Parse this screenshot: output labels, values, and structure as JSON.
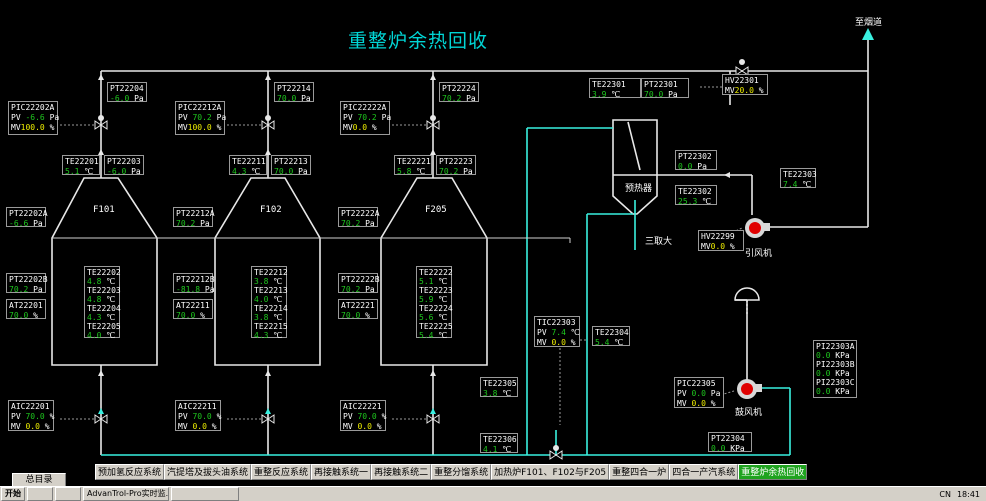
{
  "title": "重整炉余热回收",
  "exhaust_label": "至烟道",
  "reactors": [
    {
      "name": "F101",
      "pic": {
        "tag": "PIC22202A",
        "pv": "-6.6",
        "pv_unit": "Pa",
        "mv": "100.0",
        "mv_unit": "%"
      },
      "pt_top": {
        "tag": "PT22204",
        "value": "-6.0",
        "unit": "Pa"
      },
      "te_top": {
        "tag": "TE22201",
        "value": "5.1",
        "unit": "℃"
      },
      "pt_top2": {
        "tag": "PT22203",
        "value": "-6.0",
        "unit": "Pa"
      },
      "pt_side": {
        "tag": "PT22202A",
        "value": "-6.6",
        "unit": "Pa"
      },
      "pt_mid": {
        "tag": "PT22202B",
        "value": "70.2",
        "unit": "Pa"
      },
      "at": {
        "tag": "AT22201",
        "value": "70.0",
        "unit": "%"
      },
      "te_list": [
        {
          "tag": "TE22202",
          "value": "4.8",
          "unit": "℃"
        },
        {
          "tag": "TE22203",
          "value": "4.8",
          "unit": "℃"
        },
        {
          "tag": "TE22204",
          "value": "4.3",
          "unit": "℃"
        },
        {
          "tag": "TE22205",
          "value": "4.0",
          "unit": "℃"
        }
      ],
      "aic": {
        "tag": "AIC22201",
        "pv": "70.0",
        "pv_unit": "%",
        "mv": "0.0",
        "mv_unit": "%"
      }
    },
    {
      "name": "F102",
      "pic": {
        "tag": "PIC22212A",
        "pv": "70.2",
        "pv_unit": "Pa",
        "mv": "100.0",
        "mv_unit": "%"
      },
      "pt_top": {
        "tag": "PT22214",
        "value": "70.0",
        "unit": "Pa"
      },
      "te_top": {
        "tag": "TE22211",
        "value": "4.3",
        "unit": "℃"
      },
      "pt_top2": {
        "tag": "PT22213",
        "value": "70.0",
        "unit": "Pa"
      },
      "pt_side": {
        "tag": "PT22212A",
        "value": "70.2",
        "unit": "Pa"
      },
      "pt_mid": {
        "tag": "PT22212B",
        "value": "-81.8",
        "unit": "Pa"
      },
      "at": {
        "tag": "AT22211",
        "value": "70.0",
        "unit": "%"
      },
      "te_list": [
        {
          "tag": "TE22212",
          "value": "3.8",
          "unit": "℃"
        },
        {
          "tag": "TE22213",
          "value": "4.0",
          "unit": "℃"
        },
        {
          "tag": "TE22214",
          "value": "3.8",
          "unit": "℃"
        },
        {
          "tag": "TE22215",
          "value": "4.3",
          "unit": "℃"
        }
      ],
      "aic": {
        "tag": "AIC22211",
        "pv": "70.0",
        "pv_unit": "%",
        "mv": "0.0",
        "mv_unit": "%"
      }
    },
    {
      "name": "F205",
      "pic": {
        "tag": "PIC22222A",
        "pv": "70.2",
        "pv_unit": "Pa",
        "mv": "0.0",
        "mv_unit": "%"
      },
      "pt_top": {
        "tag": "PT22224",
        "value": "70.2",
        "unit": "Pa"
      },
      "te_top": {
        "tag": "TE22221",
        "value": "5.8",
        "unit": "℃"
      },
      "pt_top2": {
        "tag": "PT22223",
        "value": "70.2",
        "unit": "Pa"
      },
      "pt_side": {
        "tag": "PT22222A",
        "value": "70.2",
        "unit": "Pa"
      },
      "pt_mid": {
        "tag": "PT22222B",
        "value": "70.2",
        "unit": "Pa"
      },
      "at": {
        "tag": "AT22221",
        "value": "70.0",
        "unit": "%"
      },
      "te_list": [
        {
          "tag": "TE22222",
          "value": "5.1",
          "unit": "℃"
        },
        {
          "tag": "TE22223",
          "value": "5.9",
          "unit": "℃"
        },
        {
          "tag": "TE22224",
          "value": "5.6",
          "unit": "℃"
        },
        {
          "tag": "TE22225",
          "value": "5.4",
          "unit": "℃"
        }
      ],
      "aic": {
        "tag": "AIC22221",
        "pv": "70.0",
        "pv_unit": "%",
        "mv": "0.0",
        "mv_unit": "%"
      }
    }
  ],
  "preheater": {
    "label": "预热器",
    "te_in": {
      "tag": "TE22301",
      "value": "3.9",
      "unit": "℃"
    },
    "pt_in": {
      "tag": "PT22301",
      "value": "70.0",
      "unit": "Pa"
    },
    "pt_out": {
      "tag": "PT22302",
      "value": "0.0",
      "unit": "Pa"
    },
    "te_out": {
      "tag": "TE22302",
      "value": "25.3",
      "unit": "℃"
    }
  },
  "hv22301": {
    "tag": "HV22301",
    "mv": "20.0",
    "unit": "%"
  },
  "hv22299": {
    "tag": "HV22299",
    "mv": "0.0",
    "unit": "%"
  },
  "te22303": {
    "tag": "TE22303",
    "value": "7.4",
    "unit": "℃"
  },
  "induced_fan_label": "引风机",
  "three_take_label": "三取大",
  "tic22303": {
    "tag": "TIC22303",
    "pv": "7.4",
    "pv_unit": "℃",
    "mv": "0.0",
    "mv_unit": "%"
  },
  "te22304": {
    "tag": "TE22304",
    "value": "5.4",
    "unit": "℃"
  },
  "te22305": {
    "tag": "TE22305",
    "value": "3.8",
    "unit": "℃"
  },
  "te22306": {
    "tag": "TE22306",
    "value": "4.1",
    "unit": "℃"
  },
  "pic22305": {
    "tag": "PIC22305",
    "pv": "0.0",
    "pv_unit": "Pa",
    "mv": "0.0",
    "mv_unit": "%"
  },
  "blower_label": "鼓风机",
  "pi_group": [
    {
      "tag": "PI22303A",
      "value": "0.0",
      "unit": "KPa"
    },
    {
      "tag": "PI22303B",
      "value": "0.0",
      "unit": "KPa"
    },
    {
      "tag": "PI22303C",
      "value": "0.0",
      "unit": "KPa"
    }
  ],
  "pt22304": {
    "tag": "PT22304",
    "value": "0.0",
    "unit": "KPa"
  },
  "home_button": "总目录",
  "tabs": [
    "预加氢反应系统",
    "汽提塔及拔头油系统",
    "重整反应系统",
    "再接触系统一",
    "再接触系统二",
    "重整分馏系统",
    "加热炉F101、F102与F205",
    "重整四合一炉",
    "四合一产汽系统",
    "重整炉余热回收"
  ],
  "active_tab": "重整炉余热回收",
  "taskbar": {
    "start": "开始",
    "items": [
      "",
      "",
      "AdvanTrol-Pro实时监...",
      ""
    ],
    "tray_lang": "CN",
    "clock": "18:41"
  }
}
